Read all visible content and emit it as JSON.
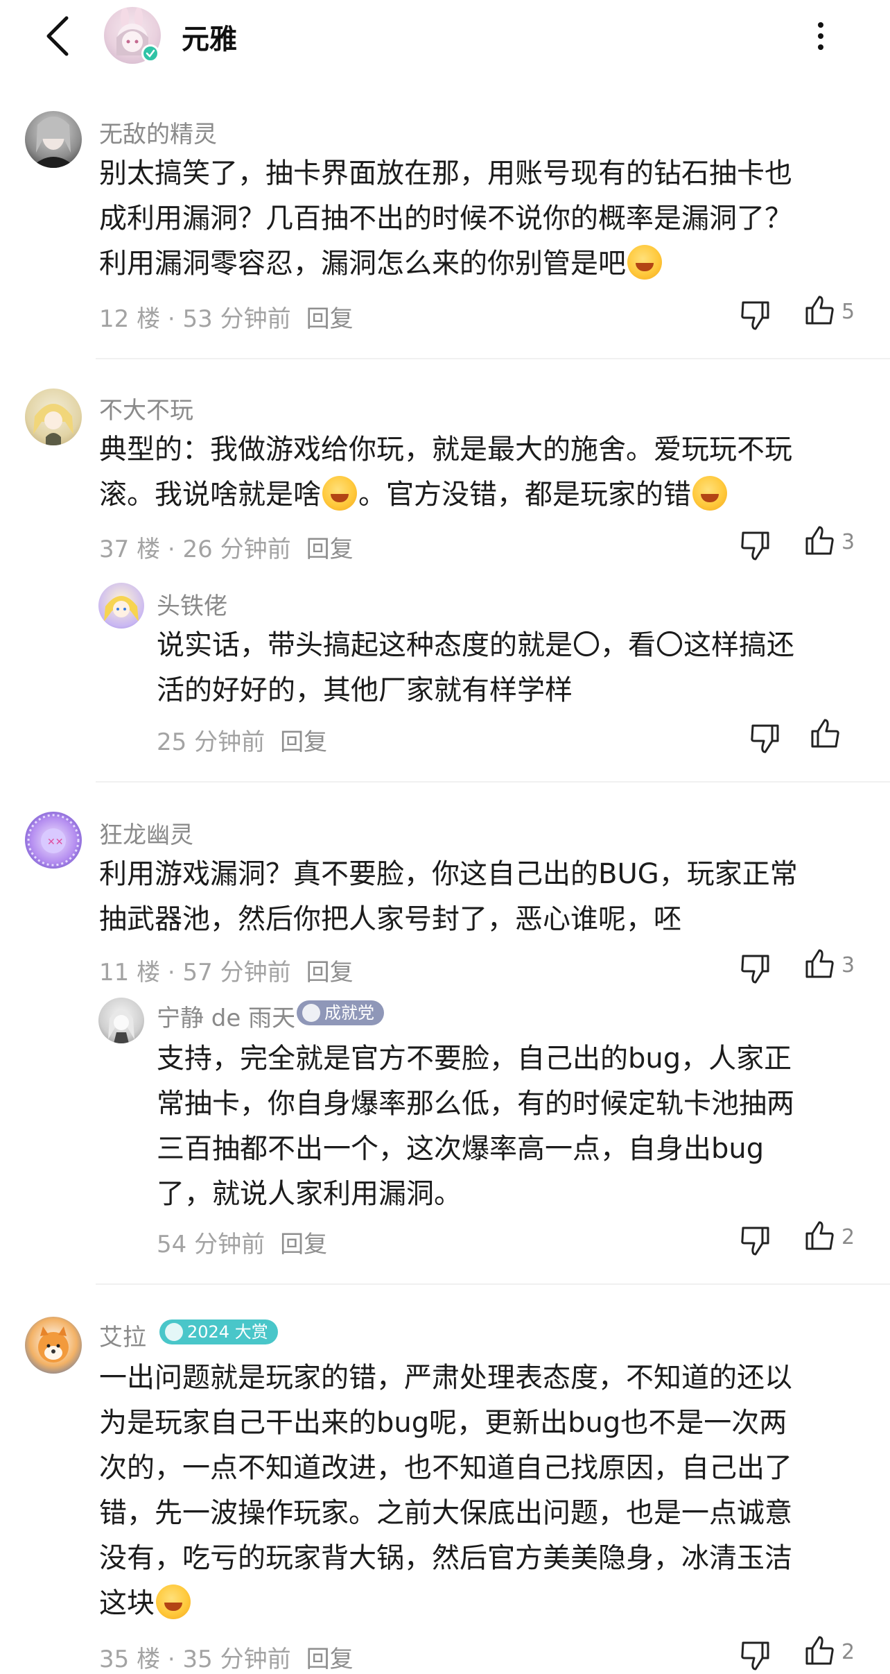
{
  "header": {
    "title": "元雅"
  },
  "comments": [
    {
      "username": "无敌的精灵",
      "text_lines": [
        "别太搞笑了，抽卡界面放在那，用账号现有的钻石抽卡也",
        "成利用漏洞？几百抽不出的时候不说你的概率是漏洞了？",
        "利用漏洞零容忍，漏洞怎么来的你别管是吧"
      ],
      "floor": "12 楼",
      "time": "53 分钟前",
      "reply_label": "回复",
      "likes": "5"
    },
    {
      "username": "不大不玩",
      "text_lines": [
        "典型的：我做游戏给你玩，就是最大的施舍。爱玩玩不玩",
        "滚。我说啥就是啥",
        "。官方没错，都是玩家的错"
      ],
      "floor": "37 楼",
      "time": "26 分钟前",
      "reply_label": "回复",
      "likes": "3",
      "reply": {
        "username": "头铁佬",
        "text_lines": [
          "说实话，带头搞起这种态度的就是〇，看〇这样搞还",
          "活的好好的，其他厂家就有样学样"
        ],
        "time": "25 分钟前",
        "reply_label": "回复"
      }
    },
    {
      "username": "狂龙幽灵",
      "text_lines": [
        "利用游戏漏洞？真不要脸，你这自己出的BUG，玩家正常",
        "抽武器池，然后你把人家号封了，恶心谁呢，呸"
      ],
      "floor": "11 楼",
      "time": "57 分钟前",
      "reply_label": "回复",
      "likes": "3",
      "reply": {
        "username": "宁静 de 雨天",
        "badge": "成就党",
        "text_lines": [
          "支持，完全就是官方不要脸，自己出的bug，人家正",
          "常抽卡，你自身爆率那么低，有的时候定轨卡池抽两",
          "三百抽都不出一个，这次爆率高一点，自身出bug",
          "了，就说人家利用漏洞。"
        ],
        "time": "54 分钟前",
        "reply_label": "回复",
        "likes": "2"
      }
    },
    {
      "username": "艾拉",
      "badge": "2024 大赏",
      "text_lines": [
        "一出问题就是玩家的错，严肃处理表态度，不知道的还以",
        "为是玩家自己干出来的bug呢，更新出bug也不是一次两",
        "次的，一点不知道改进，也不知道自己找原因，自己出了",
        "错，先一波操作玩家。之前大保底出问题，也是一点诚意",
        "没有，吃亏的玩家背大锅，然后官方美美隐身，冰清玉洁",
        "这块"
      ],
      "floor": "35 楼",
      "time": "35 分钟前",
      "reply_label": "回复",
      "likes": "2"
    }
  ],
  "colors": {
    "verified": "#30c3a6",
    "badge_achievement": "#8f97b8",
    "badge_award": "#49c6c9"
  }
}
